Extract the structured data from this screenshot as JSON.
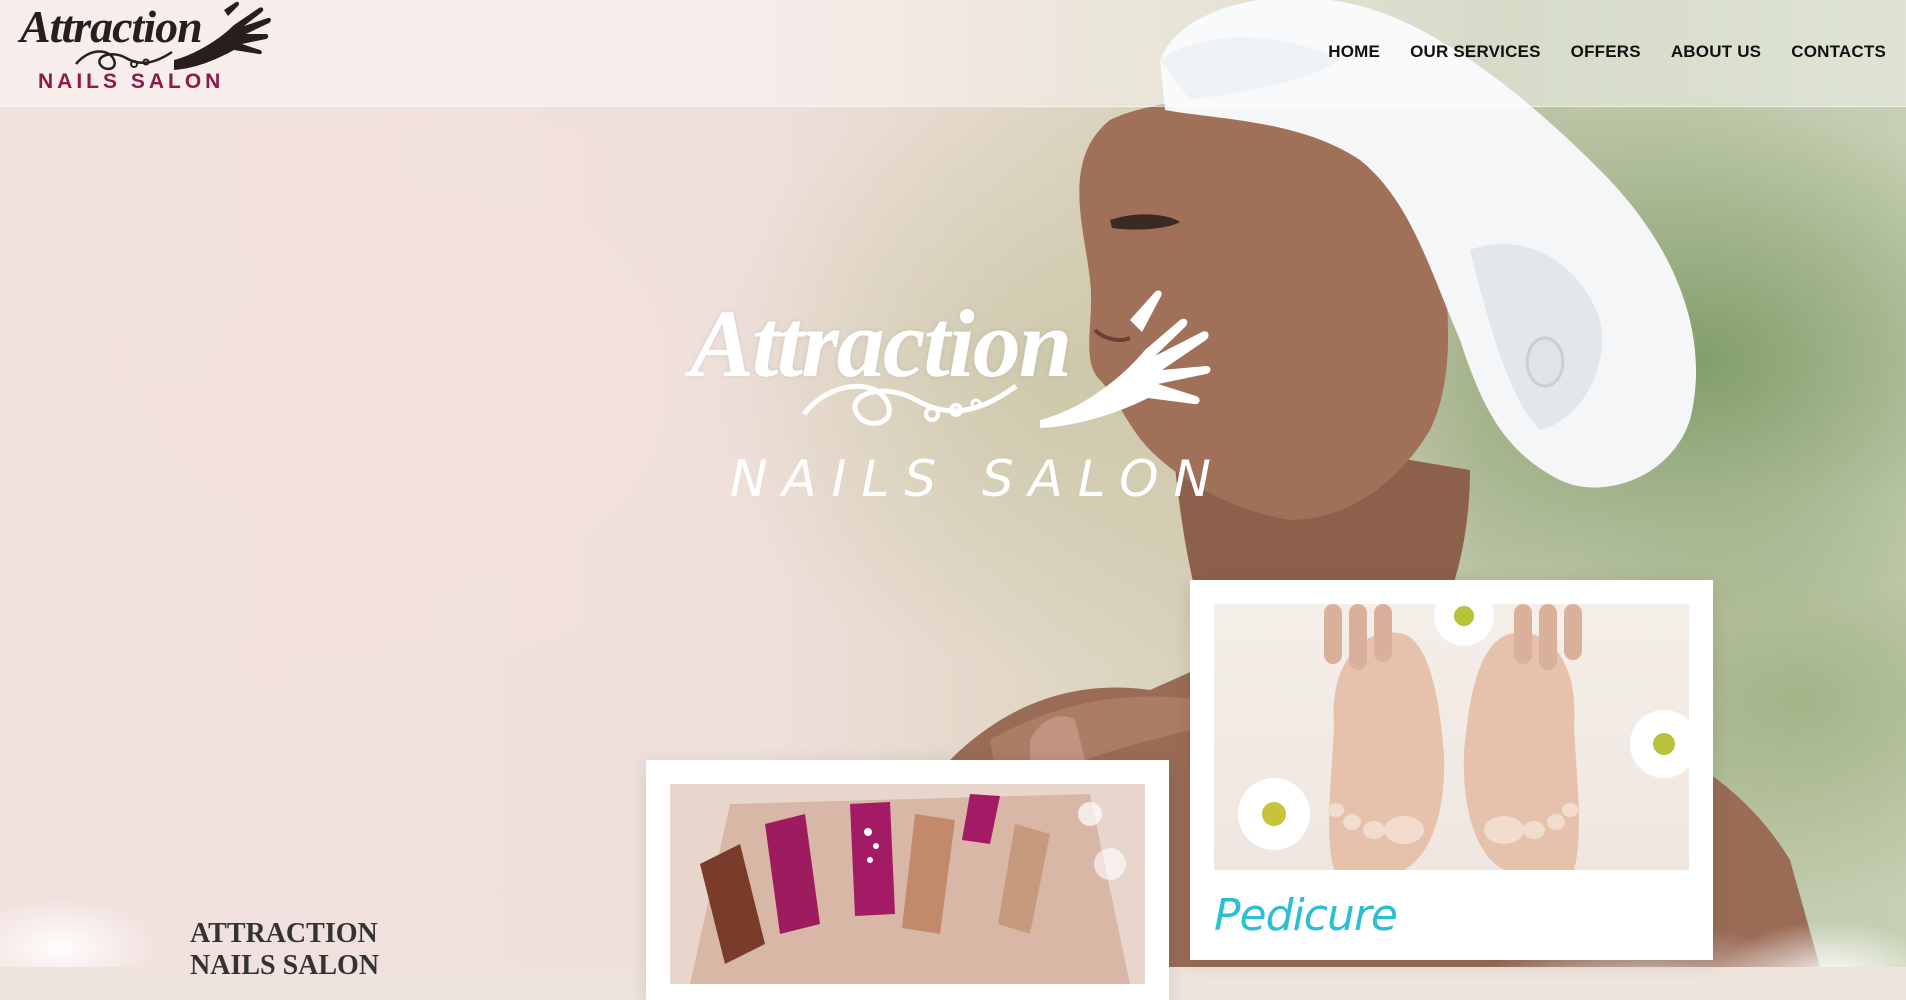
{
  "header": {
    "logo": {
      "script": "Attraction",
      "sub": "NAILS SALON"
    },
    "nav": [
      {
        "label": "HOME"
      },
      {
        "label": "OUR SERVICES"
      },
      {
        "label": "OFFERS"
      },
      {
        "label": "ABOUT US"
      },
      {
        "label": "CONTACTS"
      }
    ]
  },
  "hero": {
    "logo": {
      "script": "Attraction",
      "sub": "NAILS SALON"
    }
  },
  "cards": [
    {
      "title": "Pedicure",
      "photo": "feet-with-daisies"
    },
    {
      "title": "",
      "photo": "manicure-pink-gold-nails"
    }
  ],
  "section": {
    "heading_line1": "ATTRACTION",
    "heading_line2": "NAILS SALON"
  },
  "colors": {
    "brand_dark": "#2a1d1d",
    "brand_magenta": "#8e1a4b",
    "card_title": "#2bbfd6"
  }
}
